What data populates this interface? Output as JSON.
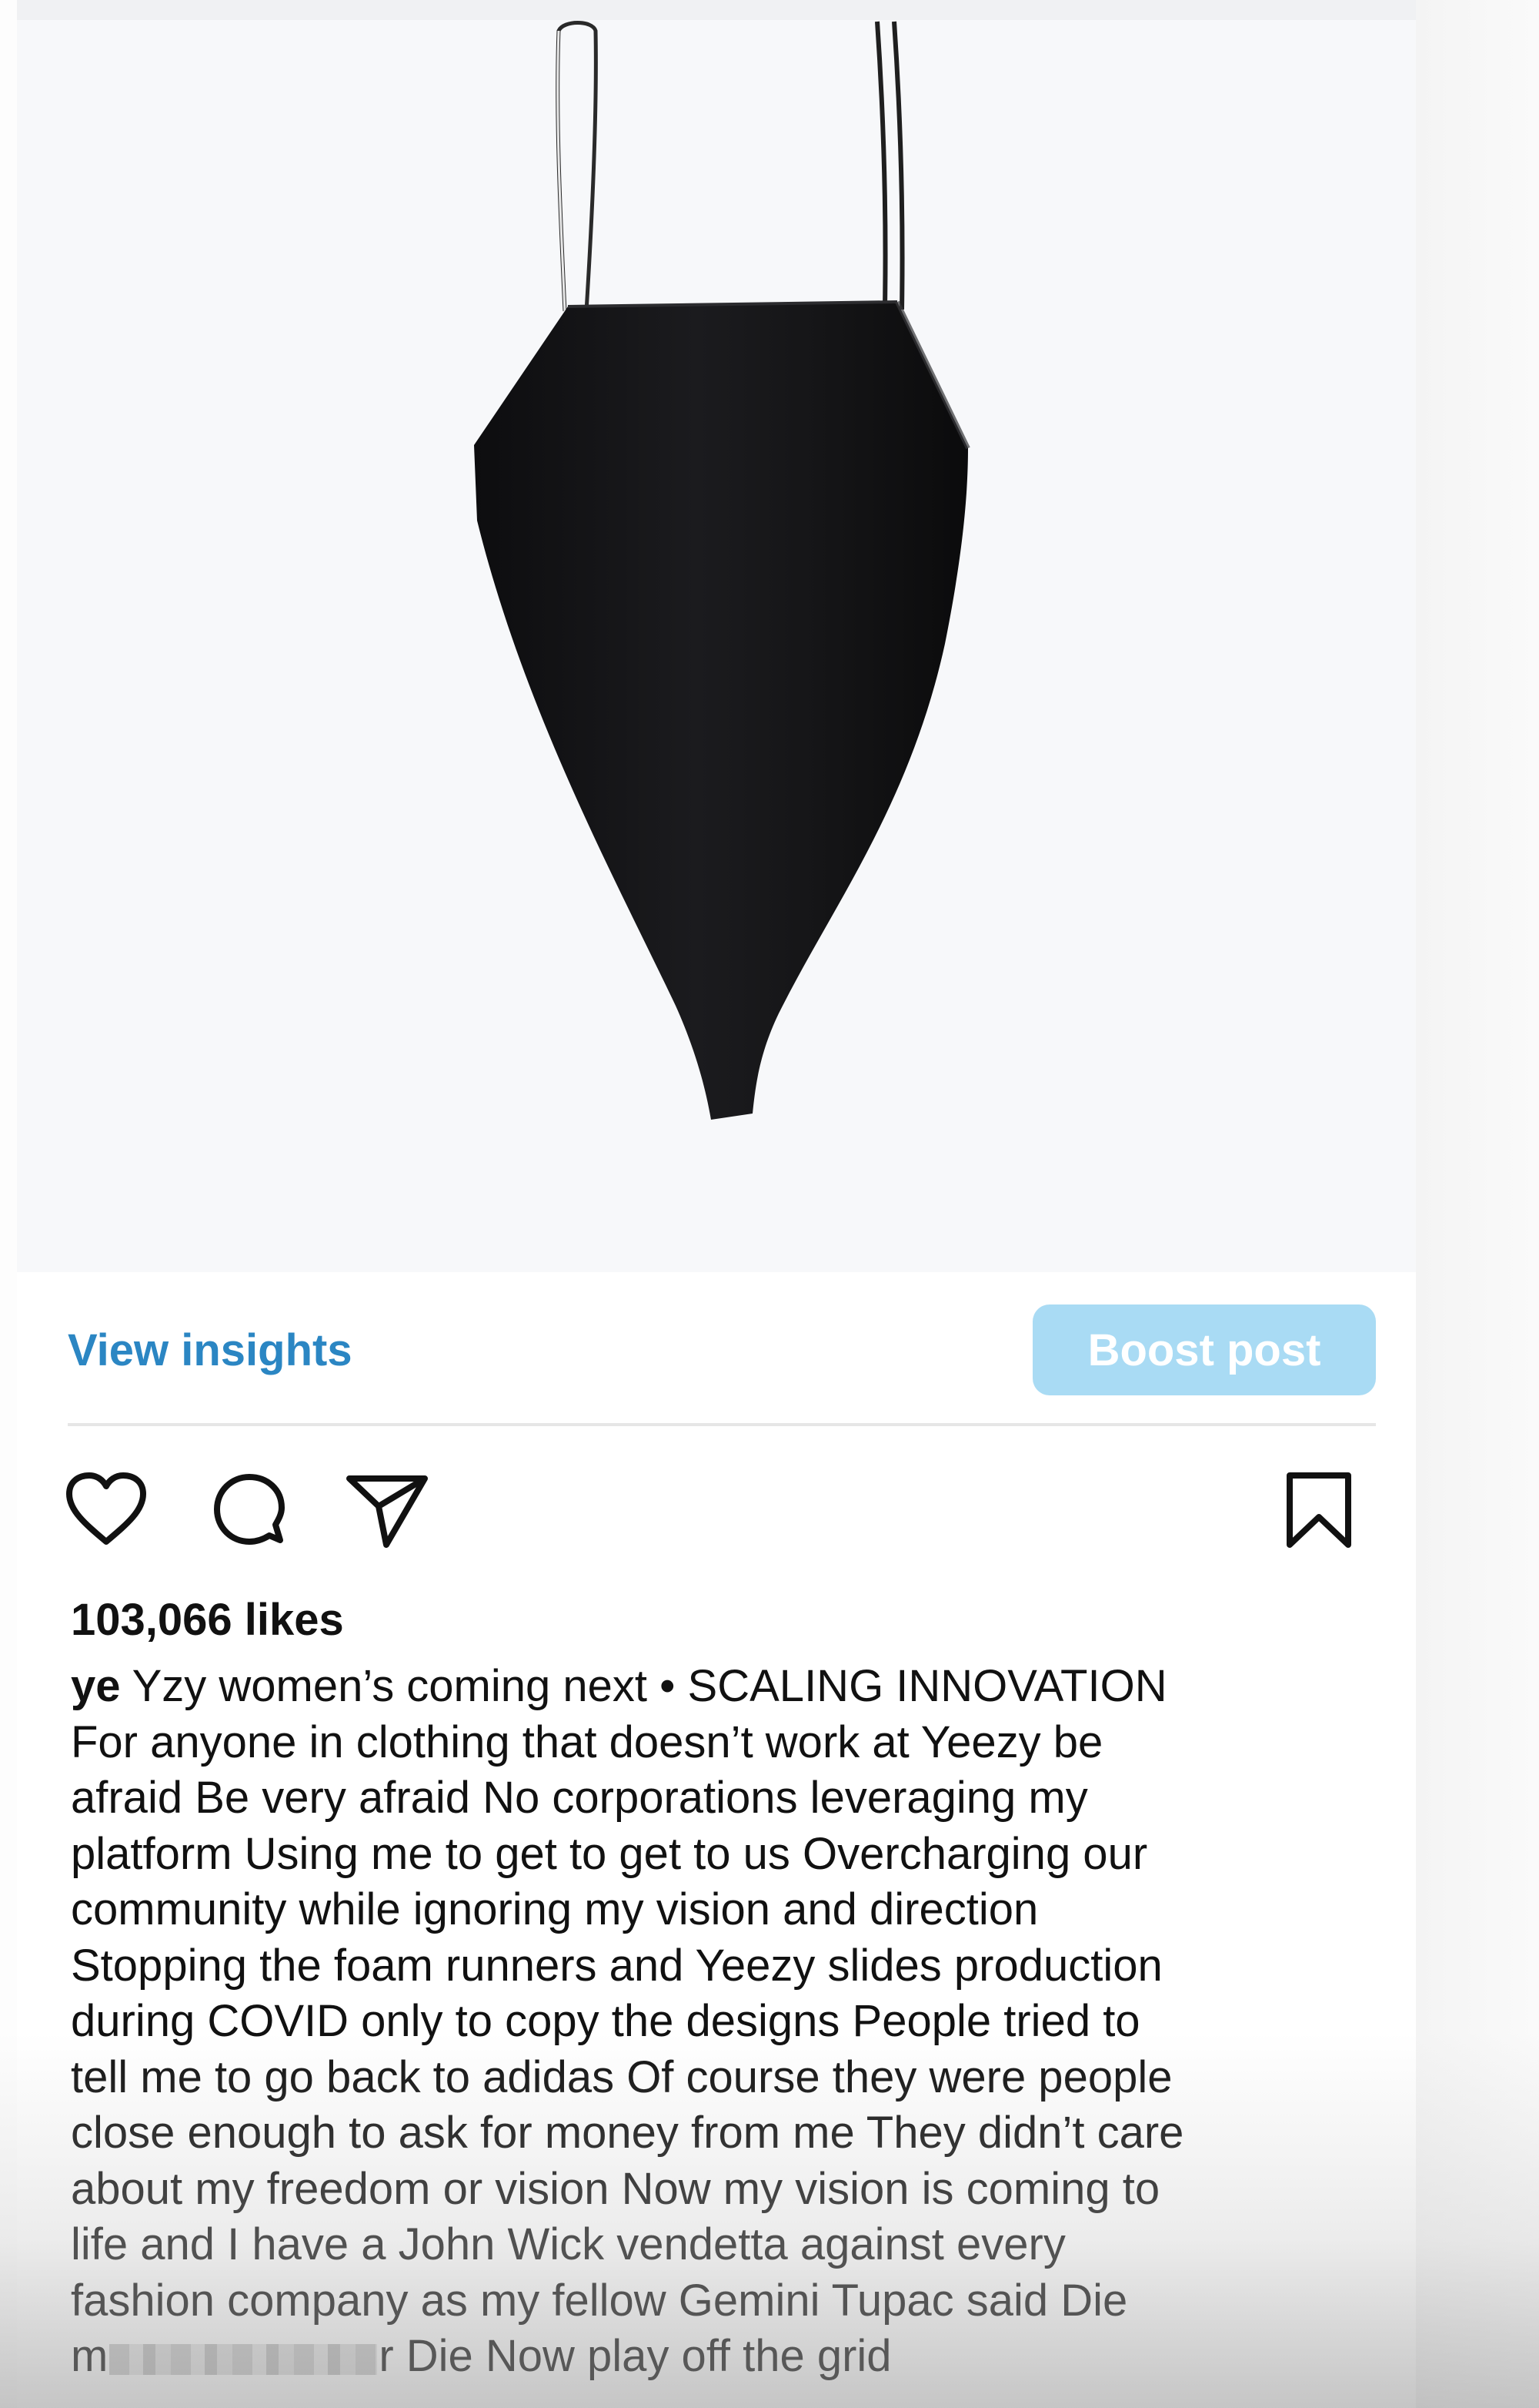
{
  "post": {
    "likes": "103,066 likes",
    "username": "ye",
    "caption_intro": " Yzy women’s coming next • SCALING INNOVATION\nFor anyone in clothing that doesn’t work at Yeezy be\nafraid Be very afraid No corporations leveraging my\nplatform Using me to get to get to us Overcharging our\ncommunity while ignoring my vision and direction\nStopping the foam runners and Yeezy slides production\nduring COVID only to copy the designs People tried to\ntell me to go back to adidas  Of course they were people\nclose enough to ask for money from me  They didn’t care\nabout my freedom or vision  Now my vision is coming to\nlife and I have a John Wick vendetta against every\nfashion company as my fellow Gemini Tupac said Die\n",
    "caption_last_start": "m",
    "caption_last_end": "r Die  Now play off the grid"
  },
  "actions": {
    "view_insights": "View insights",
    "boost_post": "Boost post"
  },
  "icons": {
    "like": "heart-icon",
    "comment": "comment-icon",
    "share": "send-icon",
    "save": "bookmark-icon"
  },
  "colors": {
    "link": "#2b86c3",
    "boost_button": "#a9dbf4",
    "media_background": "#f7f8fa",
    "garment": "#141416"
  }
}
